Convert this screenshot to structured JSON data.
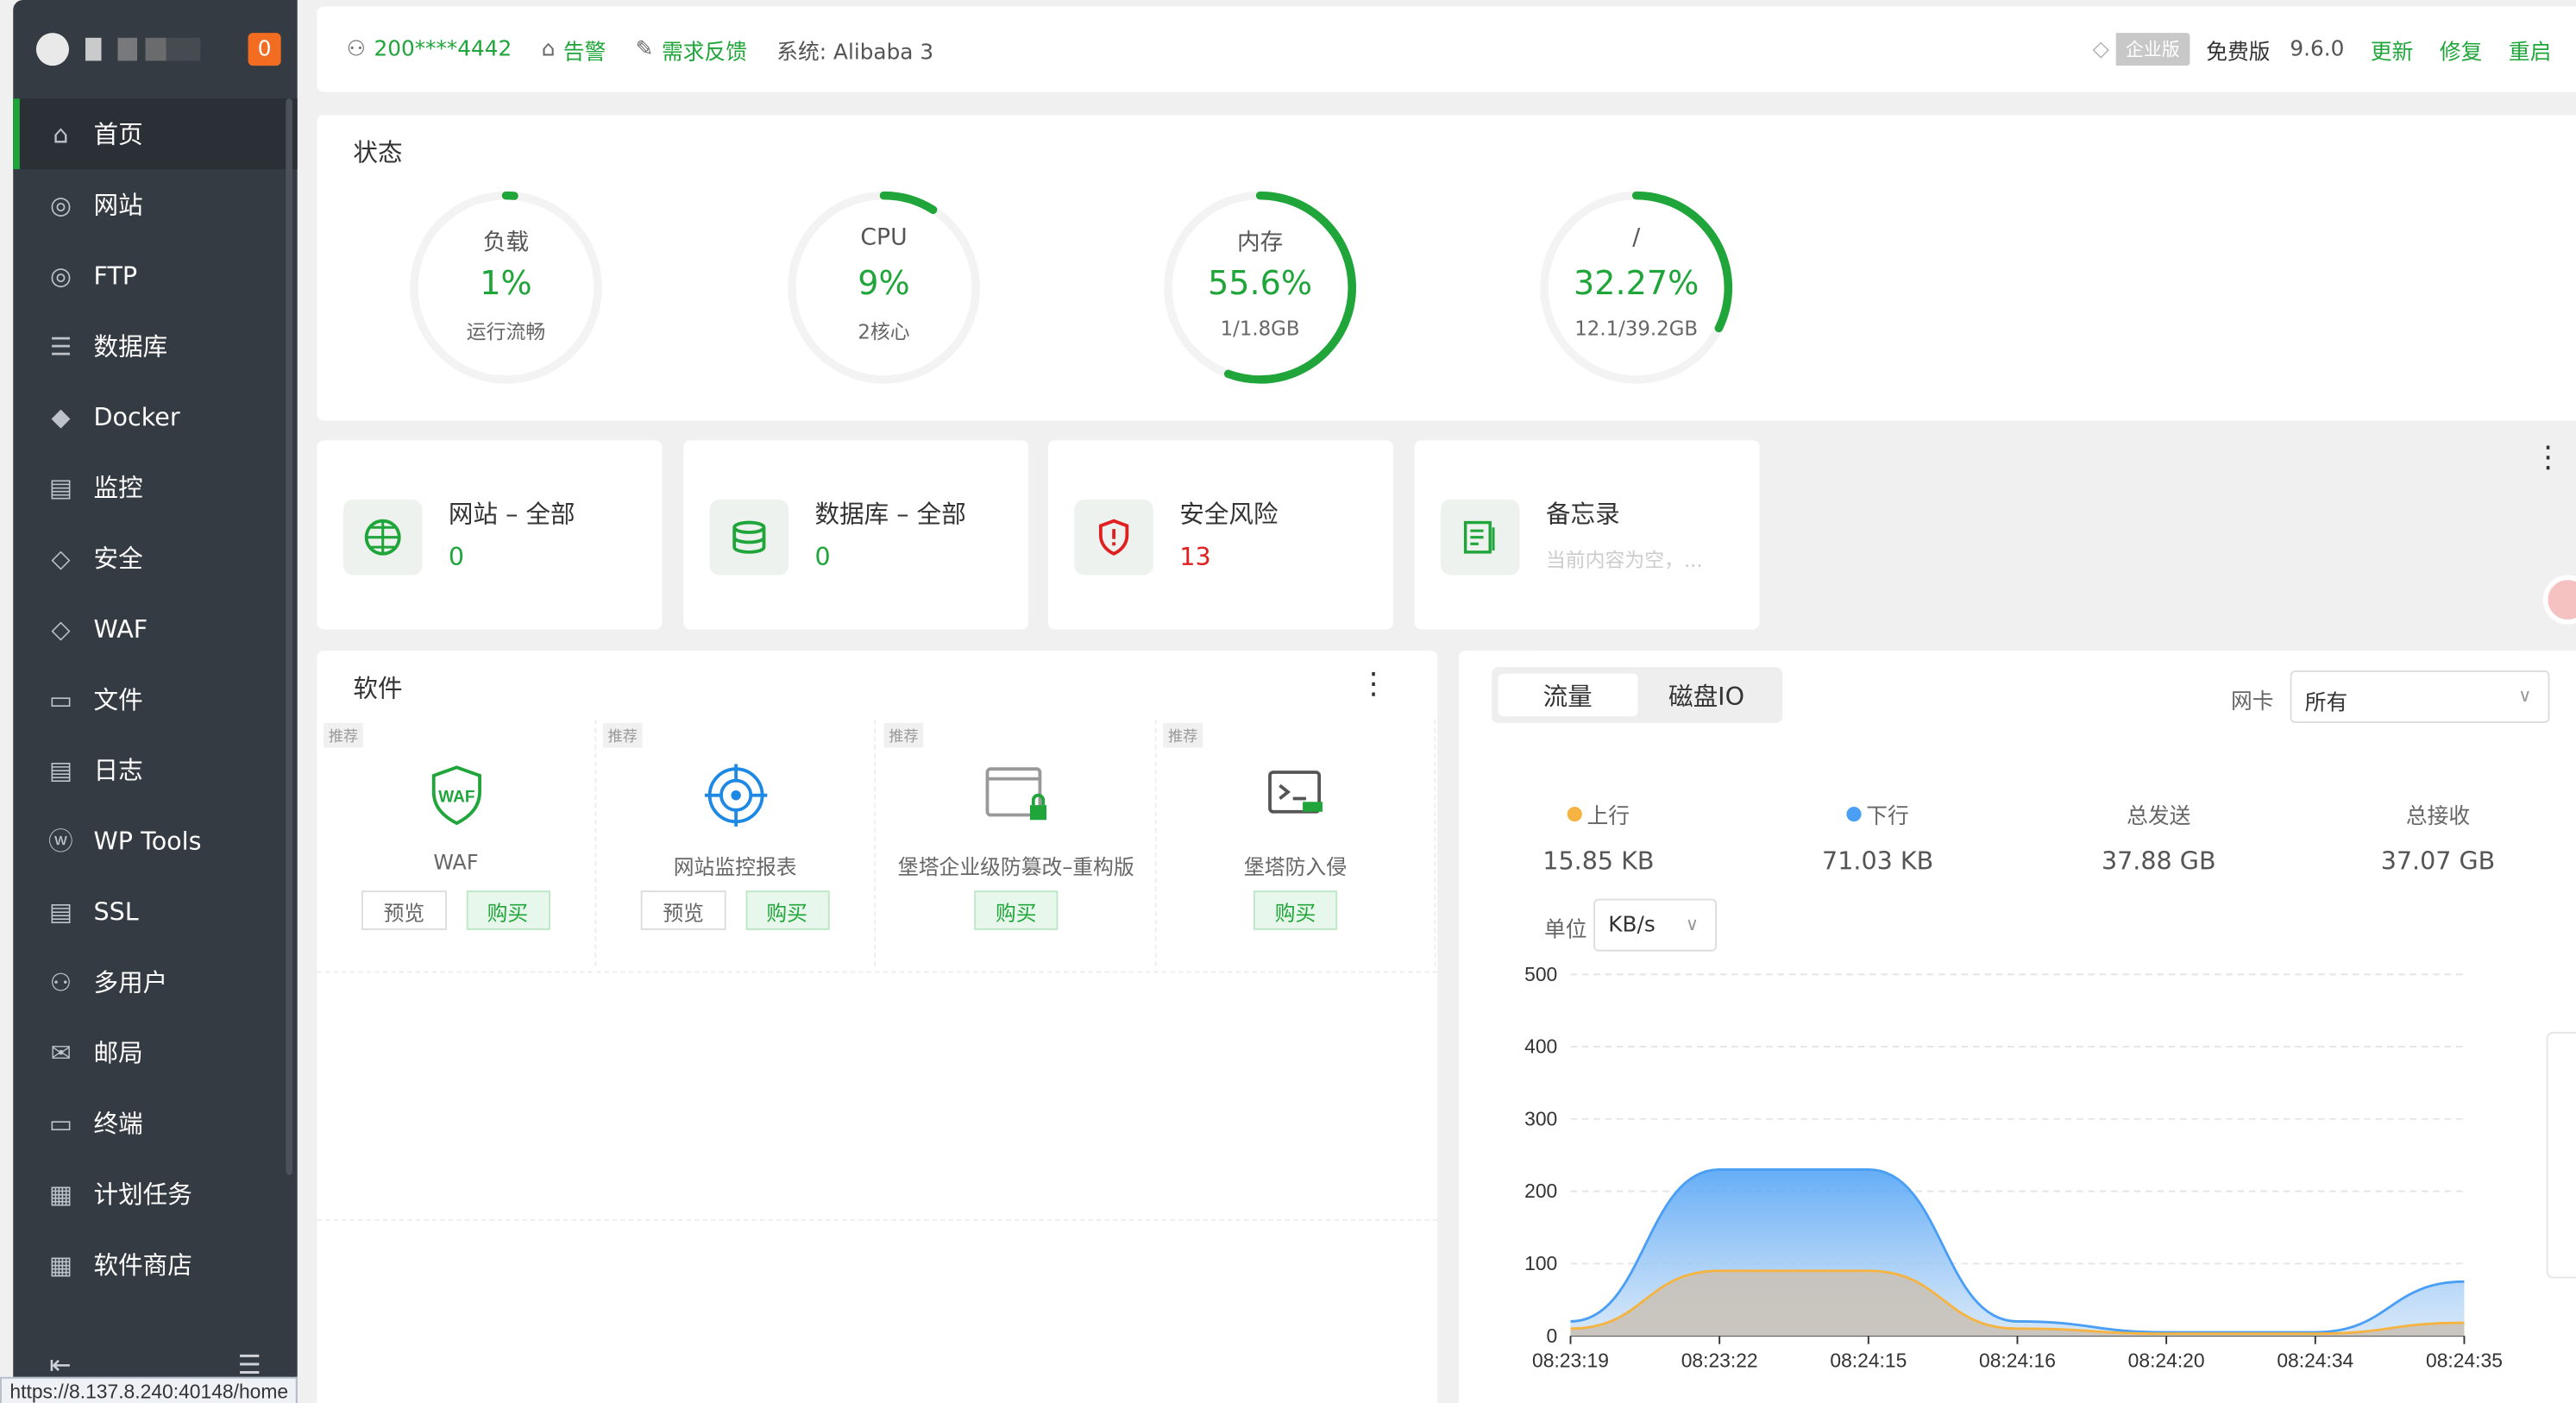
{
  "sidebar": {
    "badge": "0",
    "items": [
      {
        "label": "首页",
        "icon": "home-icon"
      },
      {
        "label": "网站",
        "icon": "globe-icon"
      },
      {
        "label": "FTP",
        "icon": "ftp-globe-icon"
      },
      {
        "label": "数据库",
        "icon": "database-icon"
      },
      {
        "label": "Docker",
        "icon": "docker-icon"
      },
      {
        "label": "监控",
        "icon": "monitor-icon"
      },
      {
        "label": "安全",
        "icon": "shield-icon"
      },
      {
        "label": "WAF",
        "icon": "waf-shield-icon"
      },
      {
        "label": "文件",
        "icon": "folder-icon"
      },
      {
        "label": "日志",
        "icon": "log-icon"
      },
      {
        "label": "WP Tools",
        "icon": "wordpress-icon"
      },
      {
        "label": "SSL",
        "icon": "ssl-icon"
      },
      {
        "label": "多用户",
        "icon": "users-icon"
      },
      {
        "label": "邮局",
        "icon": "mail-icon"
      },
      {
        "label": "终端",
        "icon": "terminal-icon"
      },
      {
        "label": "计划任务",
        "icon": "calendar-icon"
      },
      {
        "label": "软件商店",
        "icon": "grid-icon"
      }
    ]
  },
  "status_url": "https://8.137.8.240:40148/home",
  "topbar": {
    "user": "200****4442",
    "alert": "告警",
    "feedback": "需求反馈",
    "system": "系统:  Alibaba 3",
    "enterprise": "企业版",
    "edition": "免费版",
    "version": "9.6.0",
    "update": "更新",
    "repair": "修复",
    "restart": "重启"
  },
  "status": {
    "title": "状态",
    "gauges": [
      {
        "label": "负载",
        "value": "1%",
        "sub": "运行流畅",
        "percent": 1
      },
      {
        "label": "CPU",
        "value": "9%",
        "sub": "2核心",
        "percent": 9
      },
      {
        "label": "内存",
        "value": "55.6%",
        "sub": "1/1.8GB",
        "percent": 55.6
      },
      {
        "label": "/",
        "value": "32.27%",
        "sub": "12.1/39.2GB",
        "percent": 32.27
      }
    ],
    "accent": "#20a53a"
  },
  "cards": [
    {
      "title": "网站 – 全部",
      "value": "0"
    },
    {
      "title": "数据库 – 全部",
      "value": "0"
    },
    {
      "title": "安全风险",
      "value": "13"
    },
    {
      "title": "备忘录",
      "value": "当前内容为空，..."
    }
  ],
  "software": {
    "title": "软件",
    "items": [
      {
        "tag": "推荐",
        "name": "WAF",
        "preview": "预览",
        "buy": "购买"
      },
      {
        "tag": "推荐",
        "name": "网站监控报表",
        "preview": "预览",
        "buy": "购买"
      },
      {
        "tag": "推荐",
        "name": "堡塔企业级防篡改–重构版",
        "buy": "购买"
      },
      {
        "tag": "推荐",
        "name": "堡塔防入侵",
        "buy": "购买"
      }
    ]
  },
  "traffic": {
    "tabs": [
      "流量",
      "磁盘IO"
    ],
    "nic_label": "网卡",
    "nic_value": "所有",
    "stats": [
      {
        "label": "上行",
        "value": "15.85 KB",
        "color": "#f5b342"
      },
      {
        "label": "下行",
        "value": "71.03 KB",
        "color": "#4a9ff5"
      },
      {
        "label": "总发送",
        "value": "37.88 GB"
      },
      {
        "label": "总接收",
        "value": "37.07 GB"
      }
    ],
    "unit_label": "单位",
    "unit_value": "KB/s"
  },
  "chart_data": {
    "type": "area",
    "x": [
      "08:23:19",
      "08:23:22",
      "08:24:15",
      "08:24:16",
      "08:24:20",
      "08:24:34",
      "08:24:35"
    ],
    "ylim": [
      0,
      500
    ],
    "yticks": [
      0,
      100,
      200,
      300,
      400,
      500
    ],
    "grid": true,
    "series": [
      {
        "name": "下行",
        "color": "#4a9ff5",
        "values": [
          20,
          230,
          230,
          20,
          5,
          5,
          75
        ]
      },
      {
        "name": "上行",
        "color": "#f5b342",
        "values": [
          10,
          90,
          90,
          10,
          3,
          3,
          18
        ]
      }
    ]
  }
}
